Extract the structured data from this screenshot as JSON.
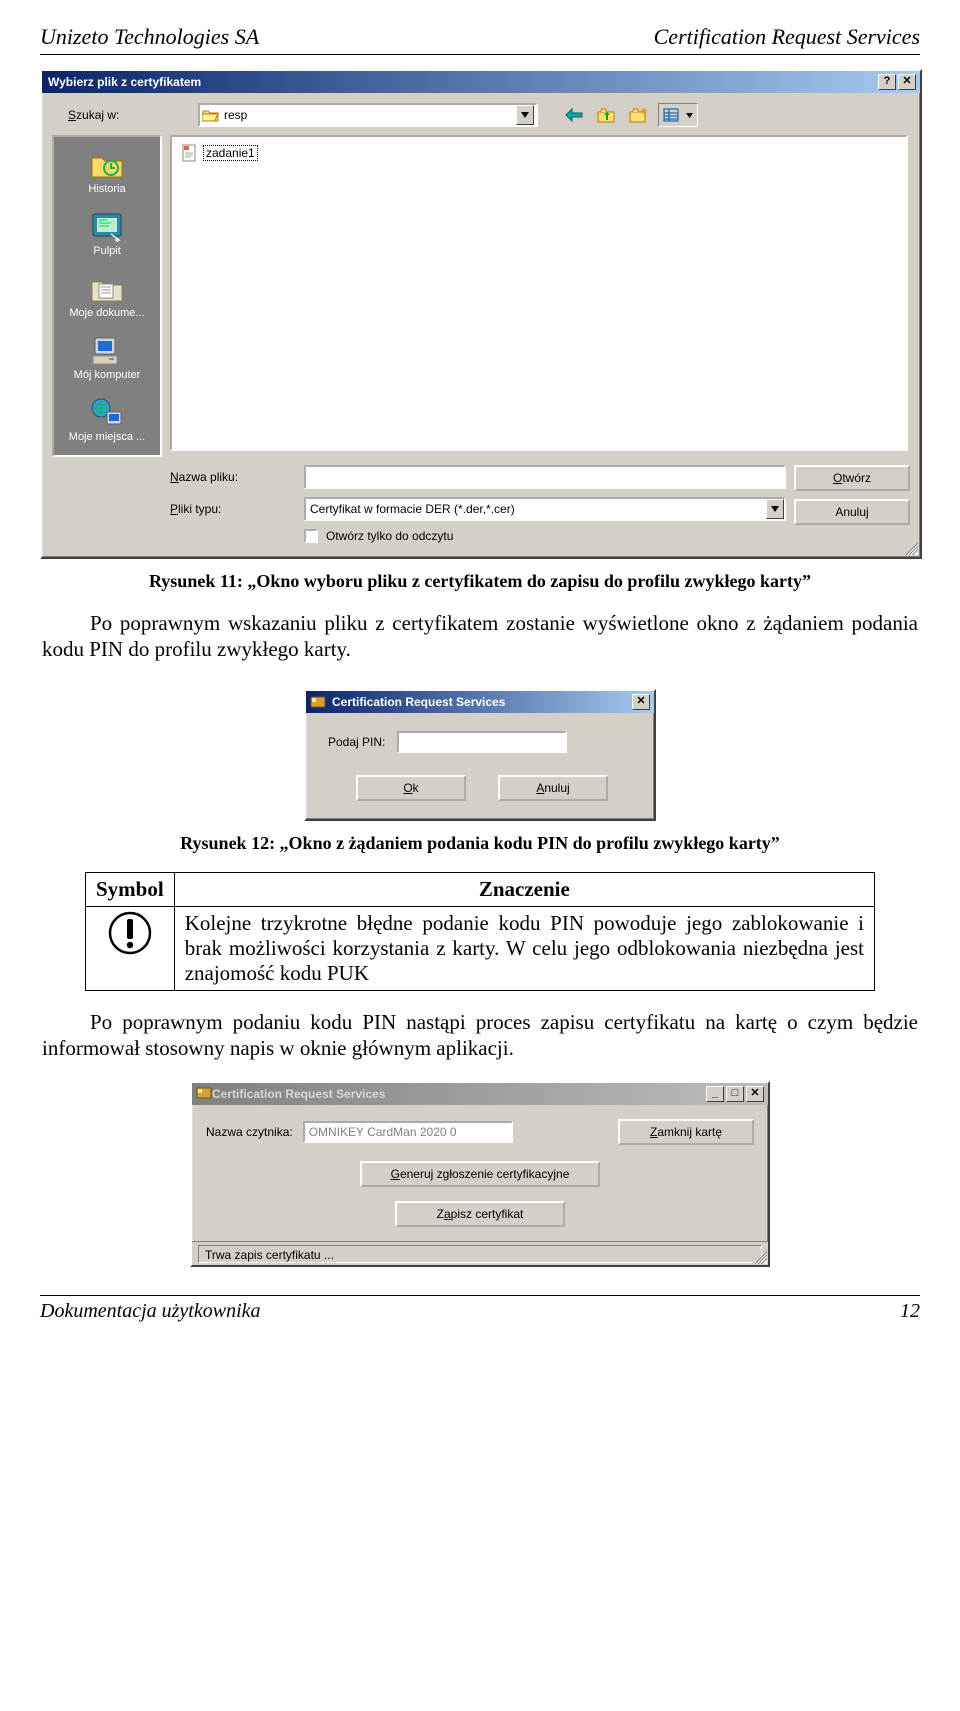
{
  "page_header": {
    "left": "Unizeto Technologies SA",
    "right": "Certification Request Services"
  },
  "page_footer": {
    "left": "Dokumentacja użytkownika",
    "right": "12"
  },
  "file_dialog": {
    "title": "Wybierz plik z certyfikatem",
    "help_btn": "?",
    "close_btn": "✕",
    "lookin_label": "Szukaj w:",
    "lookin_value": "resp",
    "file_item": "zadanie1",
    "filename_label": "Nazwa pliku:",
    "filename_value": "",
    "filetype_label": "Pliki typu:",
    "filetype_value": "Certyfikat w formacie DER (*.der,*.cer)",
    "readonly_label": "Otwórz tylko do odczytu",
    "open_btn": "Otwórz",
    "cancel_btn": "Anuluj",
    "places": {
      "history": "Historia",
      "desktop": "Pulpit",
      "mydocs": "Moje dokume...",
      "mycomputer": "Mój komputer",
      "myplaces": "Moje miejsca ..."
    }
  },
  "caption1": "Rysunek 11: „Okno wyboru pliku z certyfikatem do zapisu do profilu zwykłego karty”",
  "para1": "Po poprawnym wskazaniu pliku z certyfikatem zostanie wyświetlone okno z żądaniem podania kodu PIN do profilu zwykłego karty.",
  "pin_dialog": {
    "title": "Certification Request Services",
    "close_btn": "✕",
    "label": "Podaj PIN:",
    "ok_btn": "Ok",
    "cancel_btn": "Anuluj"
  },
  "caption2": "Rysunek 12: „Okno z żądaniem podania kodu PIN do profilu zwykłego karty”",
  "warn_table": {
    "col1": "Symbol",
    "col2": "Znaczenie",
    "icon": "!",
    "text": "Kolejne trzykrotne błędne podanie kodu PIN powoduje jego zablokowanie i brak możliwości korzystania z karty. W celu jego odblokowania niezbędna jest znajomość kodu PUK"
  },
  "para2": "Po poprawnym podaniu kodu PIN nastąpi proces zapisu certyfikatu na kartę o czym będzie informował stosowny napis w oknie głównym aplikacji.",
  "crs_dialog": {
    "title": "Certification Request Services",
    "min_btn": "_",
    "max_btn": "□",
    "close_btn": "✕",
    "reader_label": "Nazwa czytnika:",
    "reader_value": "OMNIKEY CardMan 2020 0",
    "close_card_btn": "Zamknij kartę",
    "gen_btn": "Generuj zgłoszenie certyfikacyjne",
    "save_btn": "Zapisz certyfikat",
    "status": "Trwa zapis certyfikatu ..."
  }
}
